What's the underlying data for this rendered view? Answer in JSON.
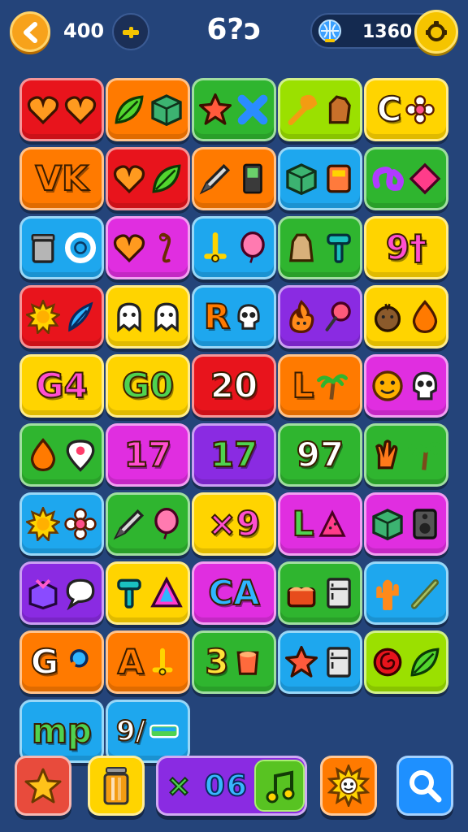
{
  "header": {
    "back_icon": "chevron-left-icon",
    "score": "400",
    "tool_icon": "pencil-icon",
    "level_title": "6?ɔ",
    "coins": "1360",
    "globe_icon": "globe-icon",
    "settings_icon": "gear-icon"
  },
  "colors": {
    "background": "#24447a",
    "red": "#e8141c",
    "orange": "#ff7a00",
    "green": "#2fb52f",
    "lime": "#9be000",
    "yellow": "#ffd400",
    "blue": "#1ea7ee",
    "magenta": "#e02ee0",
    "purple": "#8a2be2"
  },
  "tiles": [
    {
      "color": "red",
      "text": "",
      "icons": [
        "heart-icon",
        "heart-icon"
      ]
    },
    {
      "color": "orange",
      "text": "",
      "icons": [
        "leaf-icon",
        "cube-icon"
      ]
    },
    {
      "color": "green",
      "text": "",
      "icons": [
        "star-icon",
        "cross-icon"
      ]
    },
    {
      "color": "lime",
      "text": "",
      "icons": [
        "wrench-icon",
        "stump-icon"
      ]
    },
    {
      "color": "yellow",
      "text": "C",
      "icons": [
        "flower-icon"
      ]
    },
    {
      "color": "orange",
      "text": "VK",
      "icons": []
    },
    {
      "color": "red",
      "text": "",
      "icons": [
        "heart-icon",
        "leaf-icon"
      ]
    },
    {
      "color": "orange",
      "text": "",
      "icons": [
        "pencil-icon",
        "book-icon"
      ]
    },
    {
      "color": "blue",
      "text": "",
      "icons": [
        "cube-icon",
        "box-icon"
      ]
    },
    {
      "color": "green",
      "text": "",
      "icons": [
        "knot-icon",
        "diamond-icon"
      ]
    },
    {
      "color": "blue",
      "text": "",
      "icons": [
        "trash-can-icon",
        "ring-icon"
      ]
    },
    {
      "color": "magenta",
      "text": "",
      "icons": [
        "heart-icon",
        "hook-icon"
      ]
    },
    {
      "color": "blue",
      "text": "",
      "icons": [
        "pin-icon",
        "balloon-icon"
      ]
    },
    {
      "color": "green",
      "text": "",
      "icons": [
        "bag-icon",
        "hammer-icon"
      ]
    },
    {
      "color": "yellow",
      "text": "9†",
      "icons": []
    },
    {
      "color": "red",
      "text": "",
      "icons": [
        "sun-icon",
        "feather-icon"
      ]
    },
    {
      "color": "yellow",
      "text": "",
      "icons": [
        "ghost-icon",
        "ghost-icon"
      ]
    },
    {
      "color": "blue",
      "text": "R",
      "icons": [
        "skull-icon"
      ]
    },
    {
      "color": "purple",
      "text": "",
      "icons": [
        "fire-icon",
        "lollipop-icon"
      ]
    },
    {
      "color": "yellow",
      "text": "",
      "icons": [
        "coconut-icon",
        "drop-icon"
      ]
    },
    {
      "color": "yellow",
      "text": "G4",
      "icons": []
    },
    {
      "color": "yellow",
      "text": "G0",
      "icons": []
    },
    {
      "color": "red",
      "text": "20",
      "icons": []
    },
    {
      "color": "orange",
      "text": "L",
      "icons": [
        "palm-tree-icon"
      ]
    },
    {
      "color": "magenta",
      "text": "",
      "icons": [
        "smiley-icon",
        "skull-icon"
      ]
    },
    {
      "color": "green",
      "text": "",
      "icons": [
        "drop-icon",
        "map-pin-icon"
      ]
    },
    {
      "color": "magenta",
      "text": "17",
      "icons": []
    },
    {
      "color": "purple",
      "text": "17",
      "icons": []
    },
    {
      "color": "green",
      "text": "97",
      "icons": []
    },
    {
      "color": "green",
      "text": "",
      "icons": [
        "hand-icon",
        "palm-tree-icon"
      ]
    },
    {
      "color": "blue",
      "text": "",
      "icons": [
        "sun-icon",
        "flower-icon"
      ]
    },
    {
      "color": "green",
      "text": "",
      "icons": [
        "pencil-icon",
        "balloon-icon"
      ]
    },
    {
      "color": "yellow",
      "text": "×9",
      "icons": []
    },
    {
      "color": "magenta",
      "text": "L",
      "icons": [
        "watermelon-icon"
      ]
    },
    {
      "color": "magenta",
      "text": "",
      "icons": [
        "cube-icon",
        "speaker-icon"
      ]
    },
    {
      "color": "purple",
      "text": "",
      "icons": [
        "gift-box-icon",
        "speech-bubble-icon"
      ]
    },
    {
      "color": "yellow",
      "text": "",
      "icons": [
        "hammer-icon",
        "triangle-icon"
      ]
    },
    {
      "color": "magenta",
      "text": "CA",
      "icons": []
    },
    {
      "color": "green",
      "text": "",
      "icons": [
        "cake-icon",
        "fridge-icon"
      ]
    },
    {
      "color": "blue",
      "text": "",
      "icons": [
        "cactus-icon",
        "bat-icon"
      ]
    },
    {
      "color": "orange",
      "text": "G",
      "icons": [
        "magnifier-icon"
      ]
    },
    {
      "color": "orange",
      "text": "A",
      "icons": [
        "pin-icon"
      ]
    },
    {
      "color": "green",
      "text": "3",
      "icons": [
        "cup-icon"
      ]
    },
    {
      "color": "blue",
      "text": "",
      "icons": [
        "star-icon",
        "fridge-icon"
      ]
    },
    {
      "color": "lime",
      "text": "",
      "icons": [
        "spiral-icon",
        "leaf-icon"
      ]
    },
    {
      "color": "blue",
      "text": "mp",
      "icons": []
    },
    {
      "color": "blue",
      "text": "9/",
      "icons": [
        "bar-icon"
      ]
    }
  ],
  "bottom": {
    "star_icon": "star-icon",
    "bin_icon": "trash-can-icon",
    "combo_a": "×",
    "combo_b": "06",
    "music_icon": "music-note-icon",
    "sun_icon": "sun-icon",
    "search_icon": "search-icon"
  }
}
